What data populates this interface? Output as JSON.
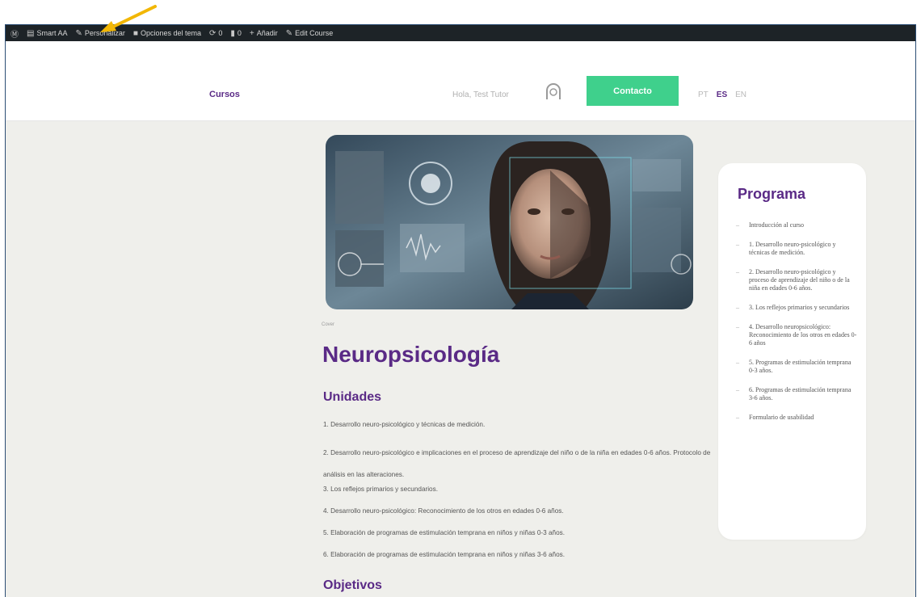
{
  "admin_bar": {
    "items": [
      {
        "icon": "wordpress-icon",
        "label": ""
      },
      {
        "icon": "dashboard-icon",
        "label": "Smart AA"
      },
      {
        "icon": "pencil-icon",
        "label": "Personalizar"
      },
      {
        "icon": "folder-icon",
        "label": "Opciones del tema"
      },
      {
        "icon": "update-icon",
        "label": "0"
      },
      {
        "icon": "comment-icon",
        "label": "0"
      },
      {
        "icon": "plus-icon",
        "label": "Añadir"
      },
      {
        "icon": "edit-icon",
        "label": "Edit Course"
      }
    ]
  },
  "header": {
    "nav_courses": "Cursos",
    "greeting": "Hola, Test Tutor",
    "contact_label": "Contacto",
    "languages": [
      {
        "code": "PT",
        "active": false
      },
      {
        "code": "ES",
        "active": true
      },
      {
        "code": "EN",
        "active": false
      }
    ]
  },
  "course": {
    "meta_label": "Cover",
    "title": "Neuropsicología",
    "units_heading": "Unidades",
    "units": [
      "1. Desarrollo neuro-psicológico y técnicas de medición.",
      "2. Desarrollo neuro-psicológico e implicaciones en el proceso de aprendizaje del niño o de la niña en edades 0-6 años. Protocolo de análisis en las alteraciones.",
      "3. Los reflejos primarios y secundarios.",
      "4. Desarrollo neuro-psicológico: Reconocimiento de los otros en edades 0-6 años.",
      "5. Elaboración de programas de estimulación temprana en niños y niñas 0-3 años.",
      "6. Elaboración de programas de estimulación temprana en niños y niñas 3-6 años."
    ],
    "objectives_heading": "Objetivos"
  },
  "program": {
    "title": "Programa",
    "items": [
      "Introducción al curso",
      "1. Desarrollo neuro-psicológico y técnicas de medición.",
      "2. Desarrollo neuro-psicológico y proceso de aprendizaje del niño o de la niña en edades 0-6 años.",
      "3. Los reflejos primarios y secundarios",
      "4. Desarrollo neuropsicológico: Reconocimiento de los otros en edades 0-6 años",
      "5. Programas de estimulación temprana 0-3 años.",
      "6. Programas de estimulación temprana 3-6 años.",
      "Formulario de usabilidad"
    ]
  },
  "colors": {
    "brand_purple": "#5a2a86",
    "contact_green": "#3fd08c",
    "annotation_arrow": "#f2b705",
    "admin_bar": "#1d2327",
    "page_background": "#efefeb"
  }
}
